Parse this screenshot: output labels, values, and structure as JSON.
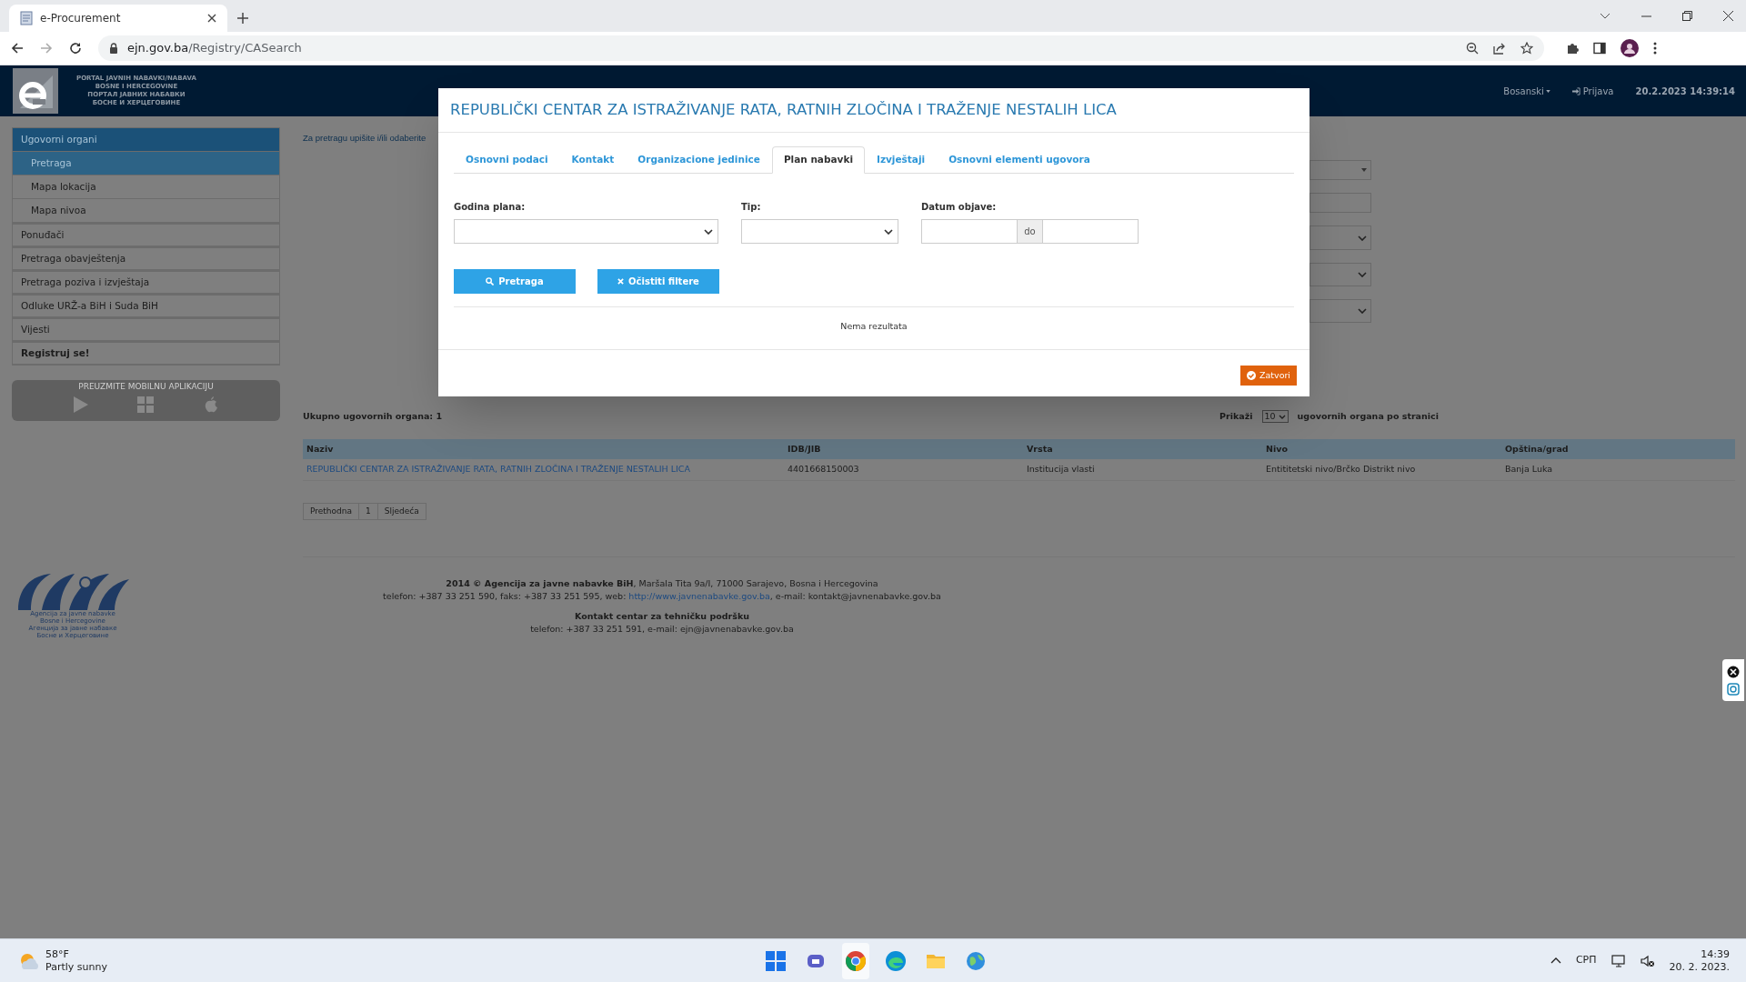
{
  "browser": {
    "tab_title": "e-Procurement",
    "url_host": "ejn.gov.ba",
    "url_path": "/Registry/CASearch"
  },
  "header": {
    "portal_lines": [
      "PORTAL JAVNIH NABAVKI/NABAVA",
      "BOSNE I HERCEGOVINE",
      "ПОРТАЛ ЈАВНИХ НАБАВКИ",
      "БОСНЕ И ХЕРЦЕГОВИНЕ"
    ],
    "language": "Bosanski",
    "login": "Prijava",
    "datetime": "20.2.2023 14:39:14"
  },
  "sidebar": {
    "items": [
      {
        "label": "Ugovorni organi",
        "kind": "link",
        "selected": true,
        "children": [
          {
            "label": "Pretraga",
            "selected": true
          },
          {
            "label": "Mapa lokacija",
            "selected": false
          },
          {
            "label": "Mapa nivoa",
            "selected": false
          }
        ]
      },
      {
        "label": "Ponuđači",
        "kind": "link",
        "selected": false
      },
      {
        "label": "Pretraga obavještenja",
        "kind": "link",
        "selected": false
      },
      {
        "label": "Pretraga poziva i izvještaja",
        "kind": "link",
        "selected": false
      },
      {
        "label": "Odluke URŽ-a BiH i Suda BiH",
        "kind": "link",
        "selected": false
      },
      {
        "label": "Vijesti",
        "kind": "link",
        "selected": false
      },
      {
        "label": "Registruj se!",
        "kind": "emphasis",
        "selected": false
      }
    ]
  },
  "mobile_app": {
    "title": "PREUZMITE MOBILNU APLIKACIJU"
  },
  "search_hint": "Za pretragu upišite i/ili odaberite",
  "results": {
    "total": "Ukupno ugovornih organa: 1",
    "show_label": "Prikaži",
    "page_size": "10",
    "per_page_label": "ugovornih organa po stranici"
  },
  "table": {
    "columns": [
      "Naziv",
      "IDB/JIB",
      "Vrsta",
      "Nivo",
      "Opština/grad"
    ],
    "rows": [
      [
        "REPUBLIČKI CENTAR ZA ISTRAŽIVANJE RATA, RATNIH ZLOČINA I TRAŽENJE NESTALIH LICA",
        "4401668150003",
        "Institucija vlasti",
        "Entititetski nivo/Brčko Distrikt nivo",
        "Banja Luka"
      ]
    ]
  },
  "pagination": [
    {
      "label": "Prethodna"
    },
    {
      "label": "1"
    },
    {
      "label": "Sljedeća"
    }
  ],
  "footer": {
    "logo_lines": [
      "Agencija za javne nabavke",
      "Bosne i Hercegovine",
      "Агенција за јавне набавке",
      "Босне и Херцеговине"
    ],
    "address": "**2014 © Agencija za javne nabavke BiH**, Maršala Tita 9a/I, 71000 Sarajevo, Bosna i Hercegovina",
    "contact_before": "telefon: +387 33 251 590, faks: +387 33 251 595, web: ",
    "contact_link": "http://www.javnenabavke.gov.ba",
    "contact_after": ", e-mail: kontakt@javnenabavke.gov.ba",
    "support_title": "Kontakt centar za tehničku podršku",
    "support_line": "telefon: +387 33 251 591, e-mail: ejn@javnenabavke.gov.ba"
  },
  "modal": {
    "title": "REPUBLIČKI CENTAR ZA ISTRAŽIVANJE RATA, RATNIH ZLOČINA I TRAŽENJE NESTALIH LICA",
    "tabs": [
      {
        "label": "Osnovni podaci",
        "selected": false
      },
      {
        "label": "Kontakt",
        "selected": false
      },
      {
        "label": "Organizacione jedinice",
        "selected": false
      },
      {
        "label": "Plan nabavki",
        "selected": true
      },
      {
        "label": "Izvještaji",
        "selected": false
      },
      {
        "label": "Osnovni elementi ugovora",
        "selected": false
      }
    ],
    "fields": [
      {
        "label": "Godina plana:",
        "kind": "select"
      },
      {
        "label": "Tip:",
        "kind": "select"
      },
      {
        "label": "Datum objave:",
        "kind": "range",
        "separator": "do"
      }
    ],
    "buttons": [
      {
        "label": "Pretraga",
        "kind": "search"
      },
      {
        "label": "Očistiti filtere",
        "kind": "clear"
      }
    ],
    "empty_text": "Nema rezultata",
    "close": "Zatvori"
  },
  "taskbar": {
    "temperature": "58°F",
    "weather": "Partly sunny",
    "language": "СРП",
    "time": "14:39",
    "date": "20. 2. 2023."
  }
}
